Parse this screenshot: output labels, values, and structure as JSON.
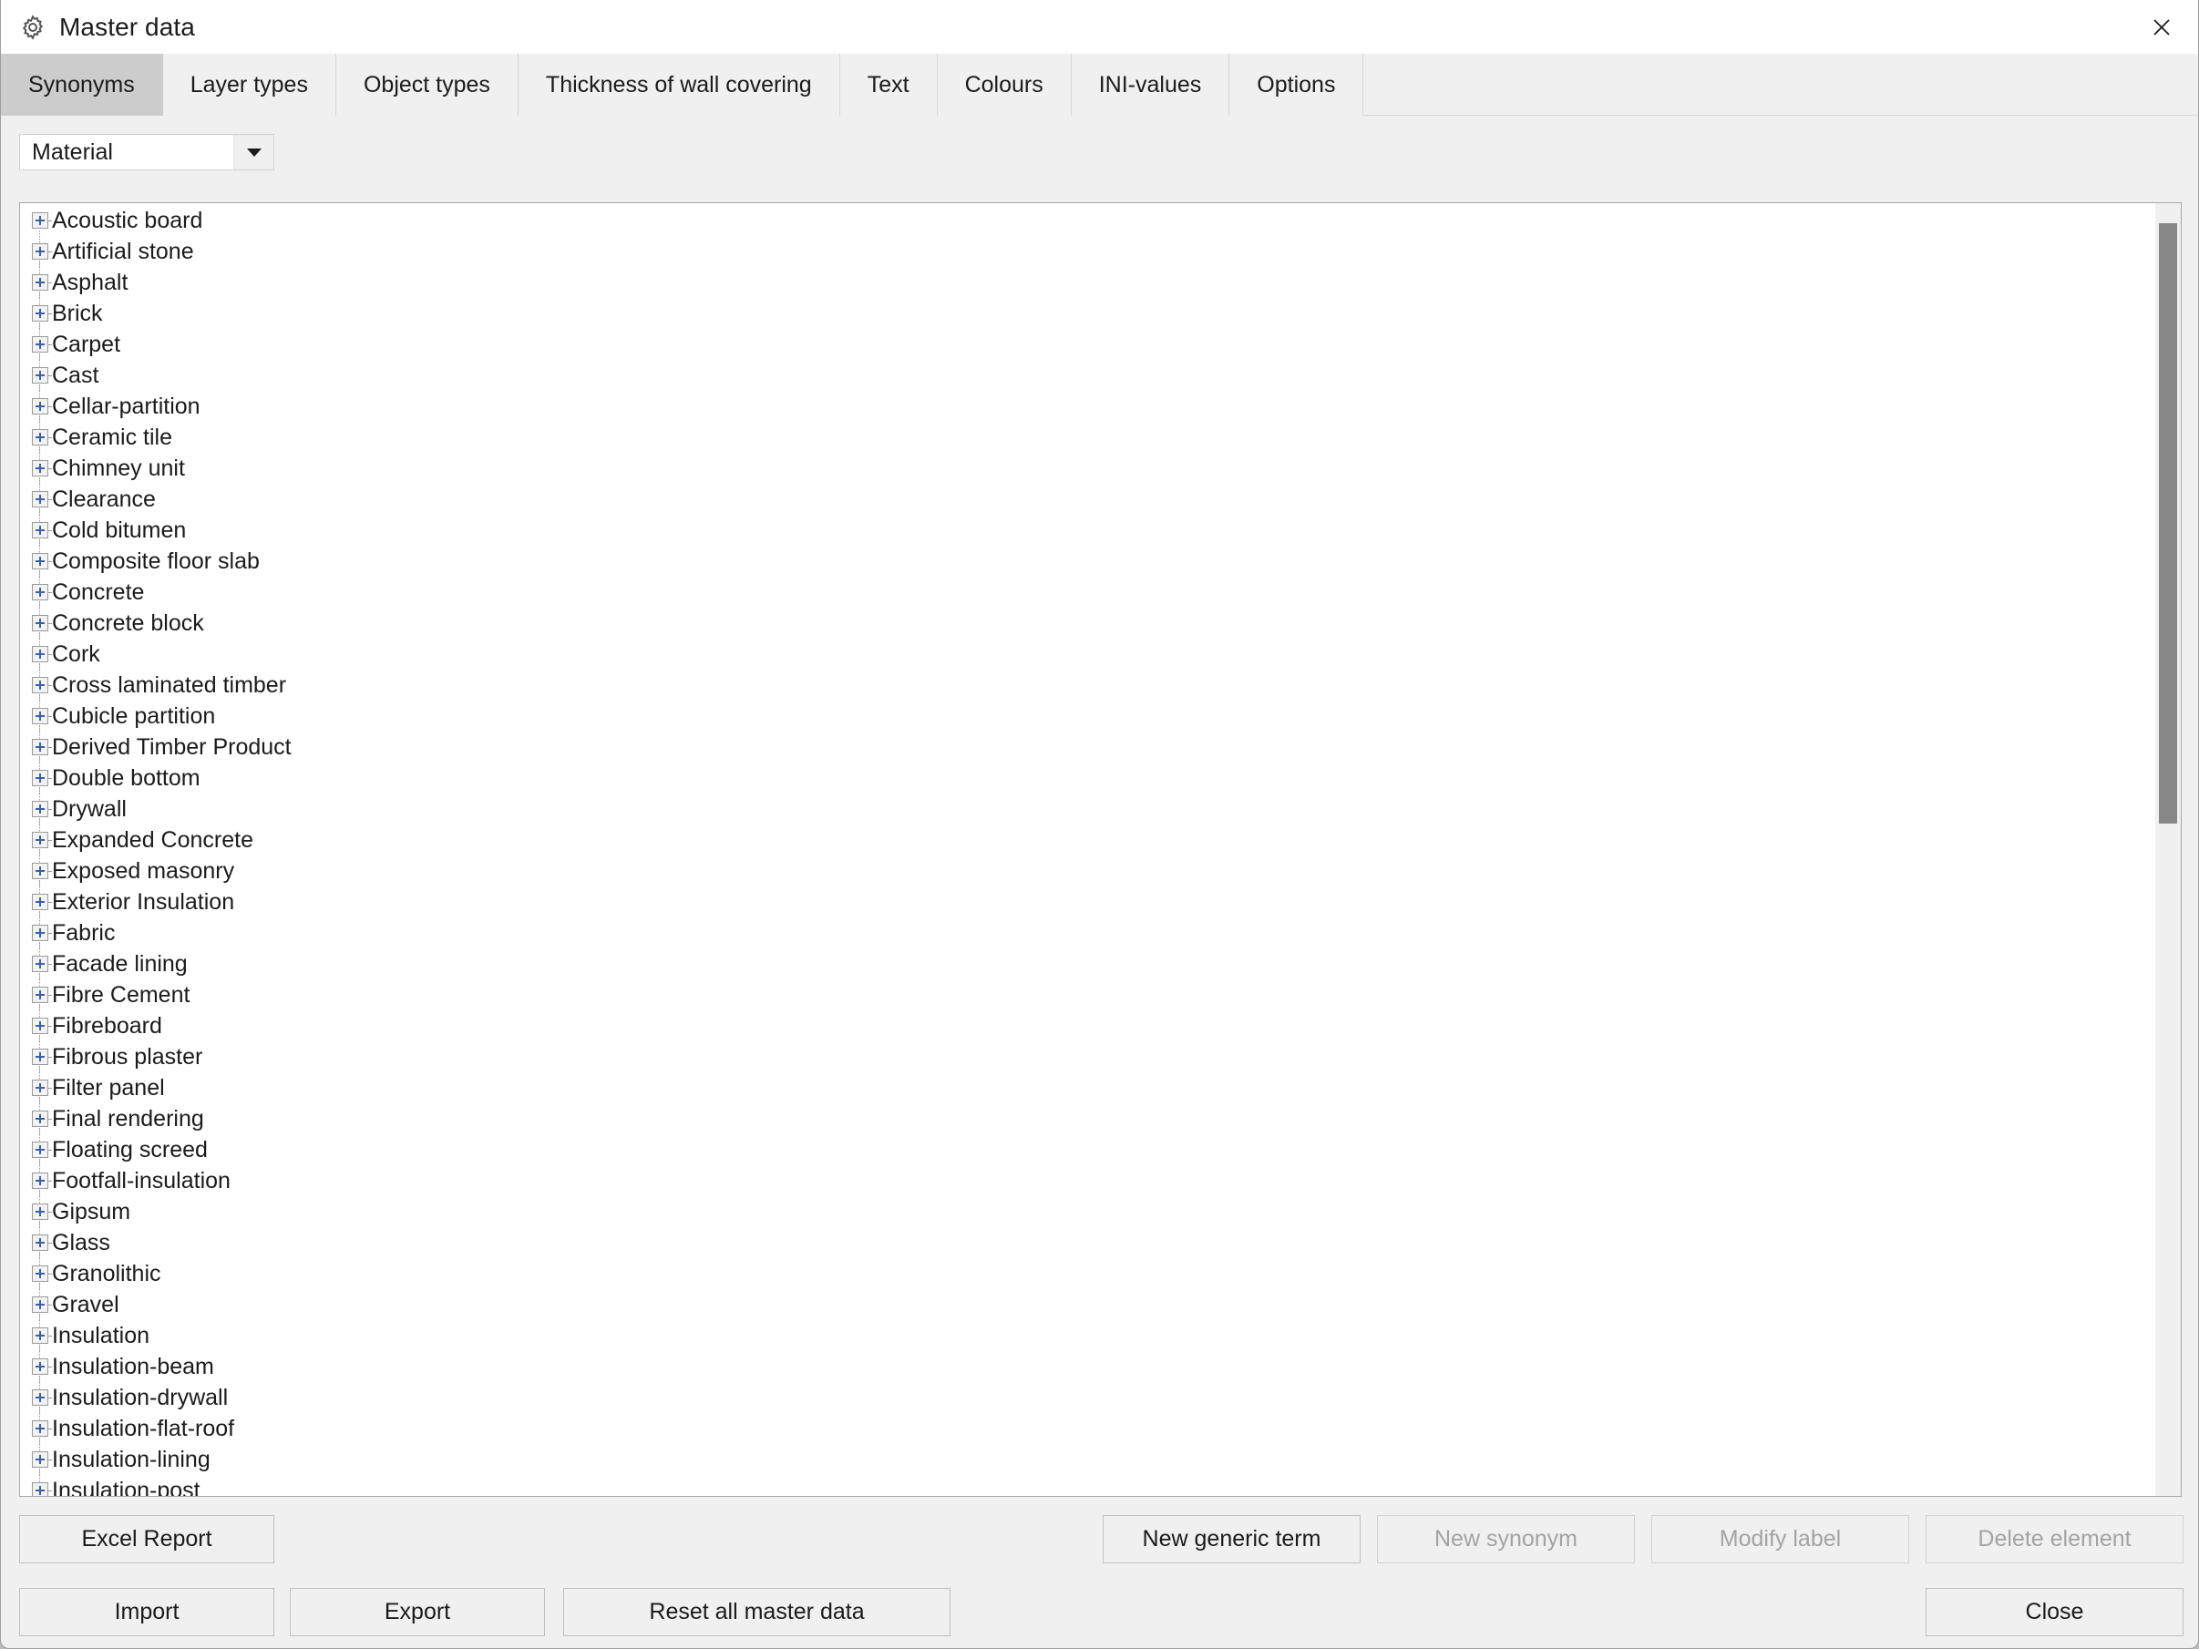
{
  "window": {
    "title": "Master data",
    "gear_icon": "gear-icon",
    "close_icon": "close-icon"
  },
  "tabs": [
    {
      "label": "Synonyms",
      "active": true
    },
    {
      "label": "Layer types",
      "active": false
    },
    {
      "label": "Object types",
      "active": false
    },
    {
      "label": "Thickness of wall covering",
      "active": false
    },
    {
      "label": "Text",
      "active": false
    },
    {
      "label": "Colours",
      "active": false
    },
    {
      "label": "INI-values",
      "active": false
    },
    {
      "label": "Options",
      "active": false
    }
  ],
  "category_select": {
    "value": "Material",
    "icon": "chevron-down-icon"
  },
  "tree": {
    "items": [
      {
        "label": "Acoustic board",
        "expander": "plus"
      },
      {
        "label": "Artificial stone",
        "expander": "plus"
      },
      {
        "label": "Asphalt",
        "expander": "plus"
      },
      {
        "label": "Brick",
        "expander": "plus"
      },
      {
        "label": "Carpet",
        "expander": "plus"
      },
      {
        "label": "Cast",
        "expander": "plus"
      },
      {
        "label": "Cellar-partition",
        "expander": "plus"
      },
      {
        "label": "Ceramic tile",
        "expander": "plus"
      },
      {
        "label": "Chimney unit",
        "expander": "plus"
      },
      {
        "label": "Clearance",
        "expander": "plus"
      },
      {
        "label": "Cold bitumen",
        "expander": "plus"
      },
      {
        "label": "Composite floor slab",
        "expander": "plus"
      },
      {
        "label": "Concrete",
        "expander": "plus"
      },
      {
        "label": "Concrete block",
        "expander": "plus"
      },
      {
        "label": "Cork",
        "expander": "plus"
      },
      {
        "label": "Cross laminated timber",
        "expander": "plus"
      },
      {
        "label": "Cubicle partition",
        "expander": "plus"
      },
      {
        "label": "Derived Timber Product",
        "expander": "plus"
      },
      {
        "label": "Double bottom",
        "expander": "plus"
      },
      {
        "label": "Drywall",
        "expander": "plus"
      },
      {
        "label": "Expanded Concrete",
        "expander": "plus"
      },
      {
        "label": "Exposed masonry",
        "expander": "plus"
      },
      {
        "label": "Exterior Insulation",
        "expander": "plus"
      },
      {
        "label": "Fabric",
        "expander": "plus"
      },
      {
        "label": "Facade lining",
        "expander": "plus"
      },
      {
        "label": "Fibre Cement",
        "expander": "plus"
      },
      {
        "label": "Fibreboard",
        "expander": "plus"
      },
      {
        "label": "Fibrous plaster",
        "expander": "plus"
      },
      {
        "label": "Filter panel",
        "expander": "plus"
      },
      {
        "label": "Final rendering",
        "expander": "plus"
      },
      {
        "label": "Floating screed",
        "expander": "plus"
      },
      {
        "label": "Footfall-insulation",
        "expander": "plus"
      },
      {
        "label": "Gipsum",
        "expander": "plus"
      },
      {
        "label": "Glass",
        "expander": "plus"
      },
      {
        "label": "Granolithic",
        "expander": "plus"
      },
      {
        "label": "Gravel",
        "expander": "plus"
      },
      {
        "label": "Insulation",
        "expander": "plus"
      },
      {
        "label": "Insulation-beam",
        "expander": "plus"
      },
      {
        "label": "Insulation-drywall",
        "expander": "plus"
      },
      {
        "label": "Insulation-flat-roof",
        "expander": "plus"
      },
      {
        "label": "Insulation-lining",
        "expander": "plus"
      },
      {
        "label": "Insulation-post",
        "expander": "plus"
      }
    ]
  },
  "buttons": {
    "excel_report": "Excel Report",
    "new_generic_term": "New generic term",
    "new_synonym": "New synonym",
    "modify_label": "Modify label",
    "delete_element": "Delete element",
    "import": "Import",
    "export": "Export",
    "reset_all": "Reset all master data",
    "close": "Close"
  },
  "colors": {
    "window_bg": "#f0f0f0",
    "tab_active_bg": "#cccccc",
    "expander_plus": "#3b5fa8",
    "scrollbar_thumb": "#888888",
    "disabled_text": "#a3a3a3"
  }
}
